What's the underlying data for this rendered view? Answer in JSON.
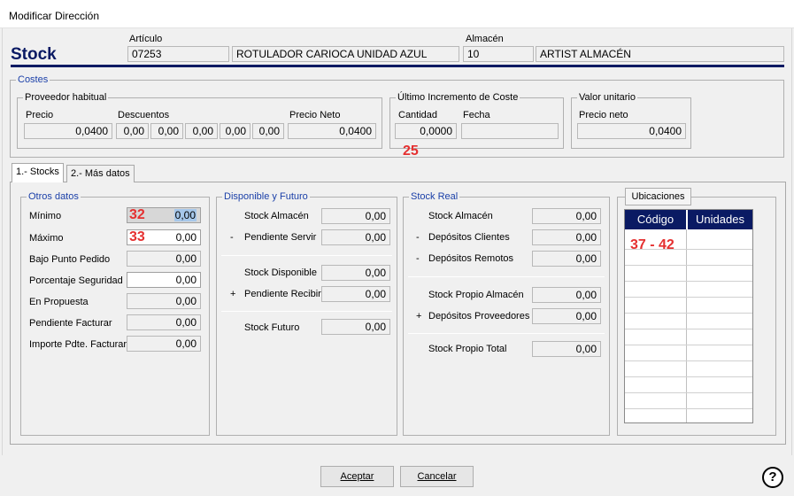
{
  "window": {
    "title": "Modificar Dirección"
  },
  "header": {
    "title": "Stock",
    "articulo_label": "Artículo",
    "articulo_code": "07253",
    "articulo_desc": "ROTULADOR CARIOCA UNIDAD AZUL",
    "almacen_label": "Almacén",
    "almacen_code": "10",
    "almacen_desc": "ARTIST ALMACÉN"
  },
  "costes": {
    "title": "Costes",
    "proveedor": {
      "title": "Proveedor habitual",
      "precio_label": "Precio",
      "precio": "0,0400",
      "descuentos_label": "Descuentos",
      "descuentos": [
        "0,00",
        "0,00",
        "0,00",
        "0,00",
        "0,00"
      ],
      "neto_label": "Precio Neto",
      "neto": "0,0400"
    },
    "incremento": {
      "title": "Último Incremento de Coste",
      "cantidad_label": "Cantidad",
      "cantidad": "0,0000",
      "fecha_label": "Fecha",
      "fecha": ""
    },
    "unitario": {
      "title": "Valor unitario",
      "neto_label": "Precio neto",
      "neto": "0,0400"
    }
  },
  "tabs": [
    {
      "label": "1.- Stocks",
      "active": true
    },
    {
      "label": "2.- Más datos",
      "active": false
    }
  ],
  "otros": {
    "title": "Otros datos",
    "rows": [
      {
        "label": "Mínimo",
        "value": "0,00"
      },
      {
        "label": "Máximo",
        "value": "0,00"
      },
      {
        "label": "Bajo Punto Pedido",
        "value": "0,00"
      },
      {
        "label": "Porcentaje Seguridad",
        "value": "0,00"
      },
      {
        "label": "En Propuesta",
        "value": "0,00"
      },
      {
        "label": "Pendiente Facturar",
        "value": "0,00"
      },
      {
        "label": "Importe Pdte. Facturar",
        "value": "0,00"
      }
    ]
  },
  "disponible": {
    "title": "Disponible y Futuro",
    "stock_almacen_label": "Stock Almacén",
    "stock_almacen": "0,00",
    "pendiente_servir_label": "Pendiente Servir",
    "pendiente_servir": "0,00",
    "stock_disponible_label": "Stock Disponible",
    "stock_disponible": "0,00",
    "pendiente_recibir_label": "Pendiente Recibir",
    "pendiente_recibir": "0,00",
    "stock_futuro_label": "Stock Futuro",
    "stock_futuro": "0,00"
  },
  "real": {
    "title": "Stock Real",
    "stock_almacen_label": "Stock Almacén",
    "stock_almacen": "0,00",
    "dep_clientes_label": "Depósitos Clientes",
    "dep_clientes": "0,00",
    "dep_remotos_label": "Depósitos Remotos",
    "dep_remotos": "0,00",
    "propio_almacen_label": "Stock Propio Almacén",
    "propio_almacen": "0,00",
    "dep_proveedores_label": "Depósitos Proveedores",
    "dep_proveedores": "0,00",
    "propio_total_label": "Stock Propio Total",
    "propio_total": "0,00"
  },
  "ubicaciones": {
    "button_label": "Ubicaciones",
    "col_codigo": "Código",
    "col_unidades": "Unidades"
  },
  "signs": {
    "minus": "-",
    "plus": "+"
  },
  "annotations": {
    "n25": "25",
    "n32": "32",
    "n33": "33",
    "n37_42": "37 - 42"
  },
  "footer": {
    "accept_label": "Aceptar",
    "cancel_label": "Cancelar",
    "help_label": "?"
  },
  "colors": {
    "title_blue": "#0a1a63",
    "annotation_red": "#e53030",
    "grid_header": "#0a1a63"
  }
}
